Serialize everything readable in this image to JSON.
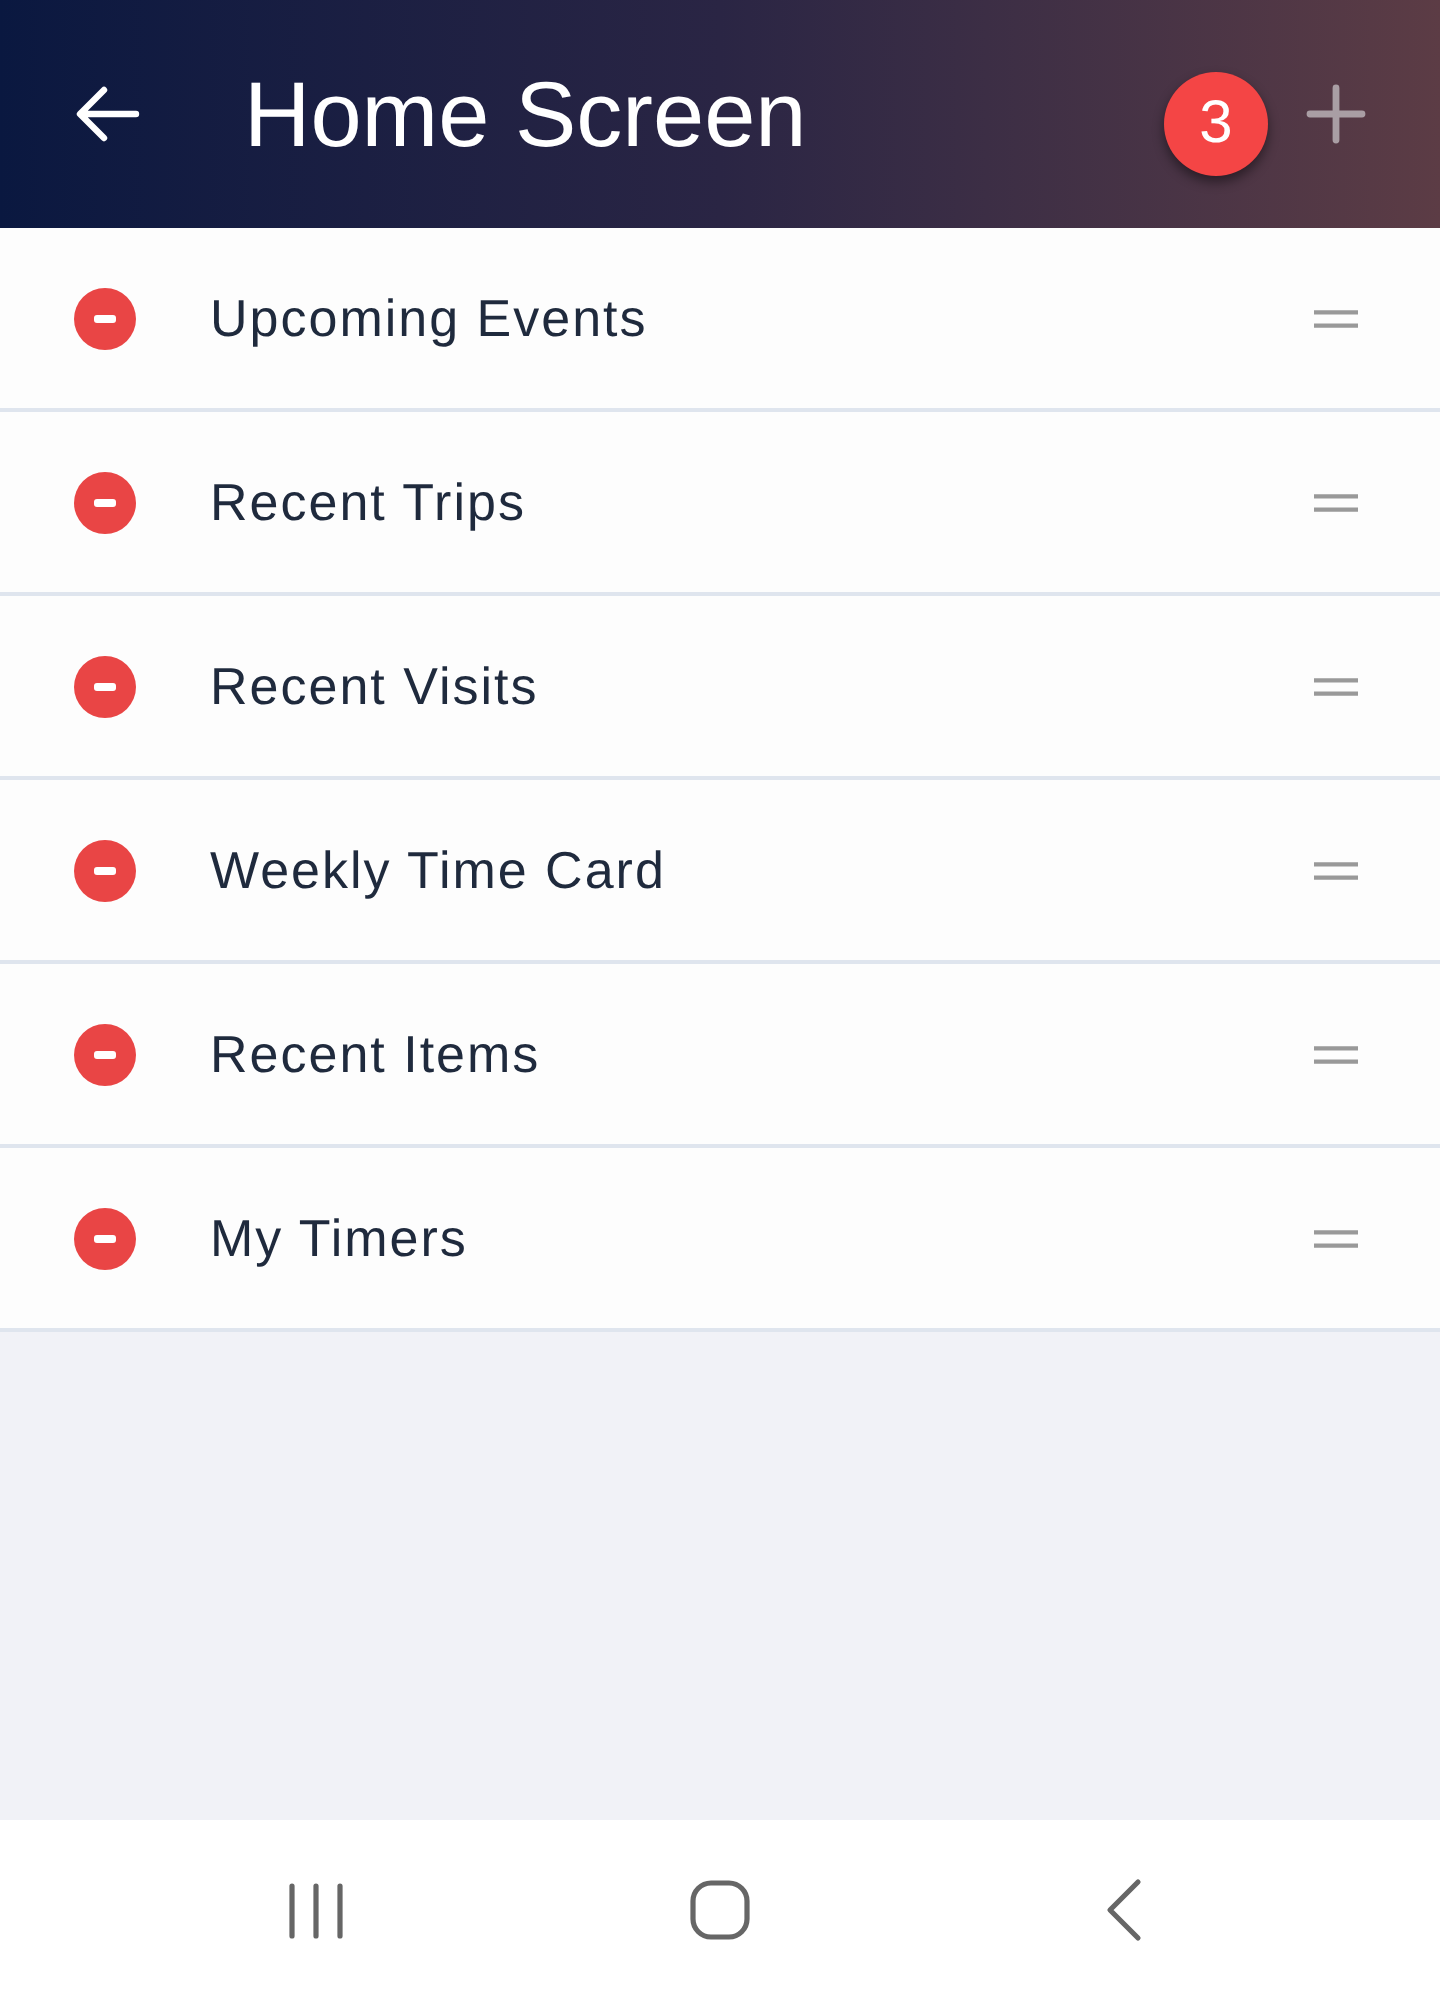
{
  "header": {
    "title": "Home Screen",
    "badge": "3"
  },
  "widgets": [
    {
      "label": "Upcoming Events"
    },
    {
      "label": "Recent Trips"
    },
    {
      "label": "Recent Visits"
    },
    {
      "label": "Weekly Time Card"
    },
    {
      "label": "Recent Items"
    },
    {
      "label": "My Timers"
    }
  ]
}
